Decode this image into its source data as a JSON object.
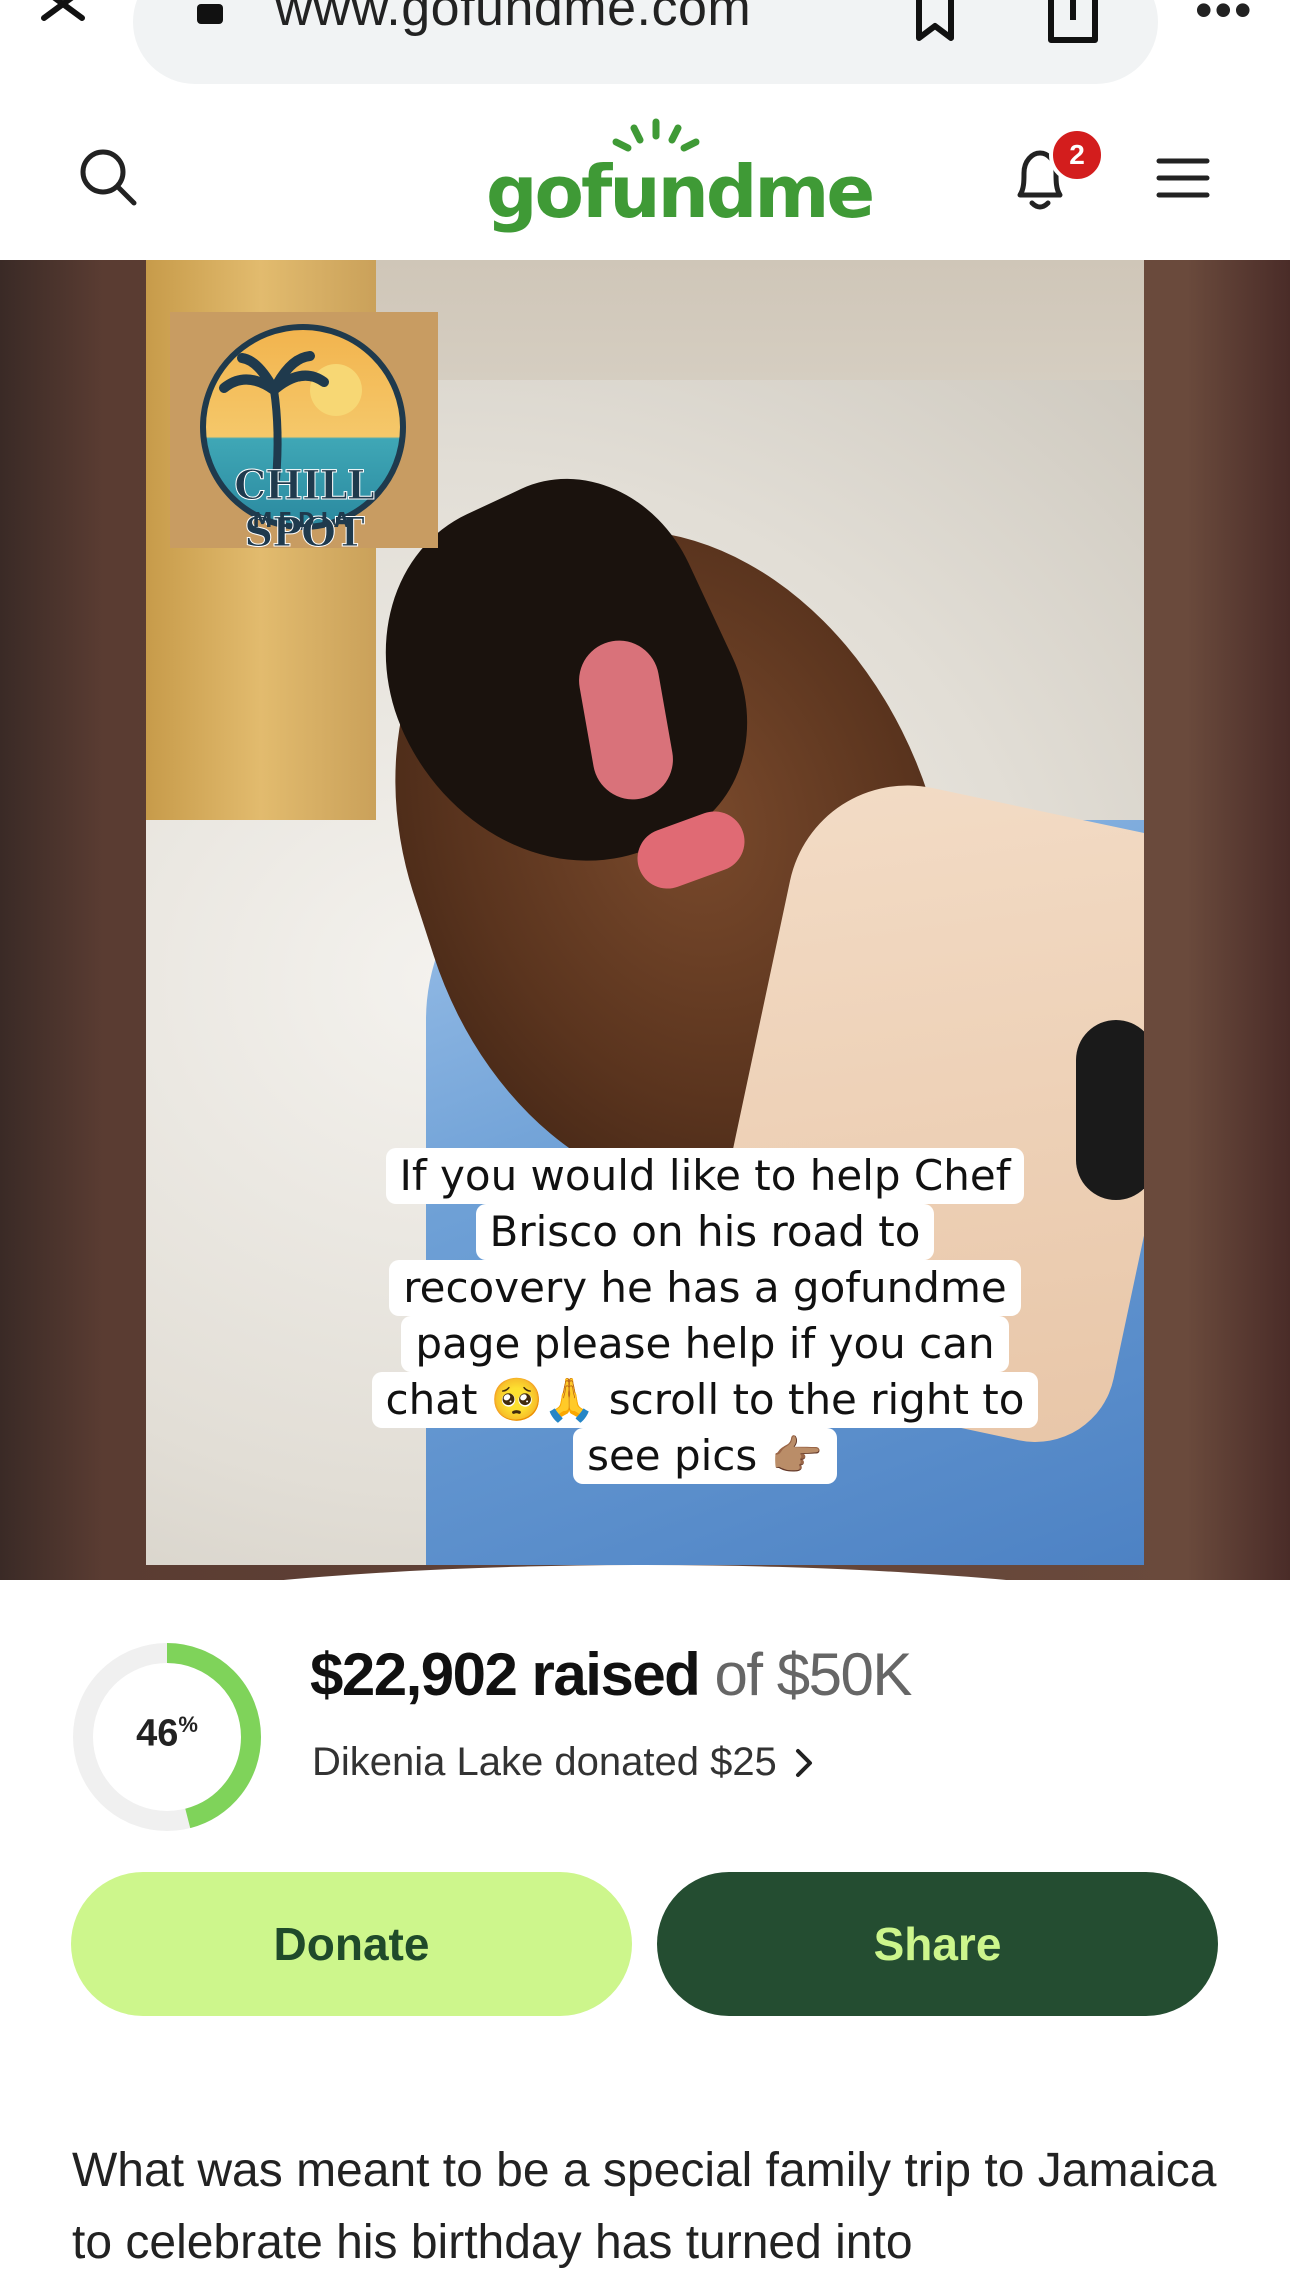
{
  "browser": {
    "url": "www.gofundme.com"
  },
  "header": {
    "logo": "gofundme",
    "notification_count": "2"
  },
  "hero": {
    "overlay_brand": "CHILL SPOT",
    "overlay_brand_sub": "MEDIA",
    "caption_lines": [
      "If you would like to help Chef",
      "Brisco on his road to",
      "recovery he has a gofundme",
      "page please help if you can",
      "chat 🥺🙏 scroll to the right to",
      "see pics 👉🏽"
    ]
  },
  "fundraiser": {
    "progress_percent": 46,
    "progress_label": "46",
    "raised_amount": "$22,902 raised",
    "goal_text": "of $50K",
    "recent_donation": "Dikenia Lake donated $25",
    "donate_label": "Donate",
    "share_label": "Share"
  },
  "story": {
    "text": "What was meant to be a special family trip to Jamaica to celebrate his birthday has turned into"
  },
  "colors": {
    "brand_green": "#3f9a36",
    "donate_bg": "#cdf68c",
    "share_bg": "#244d31",
    "progress_fill": "#7fd35a",
    "badge_red": "#d31d1d"
  }
}
